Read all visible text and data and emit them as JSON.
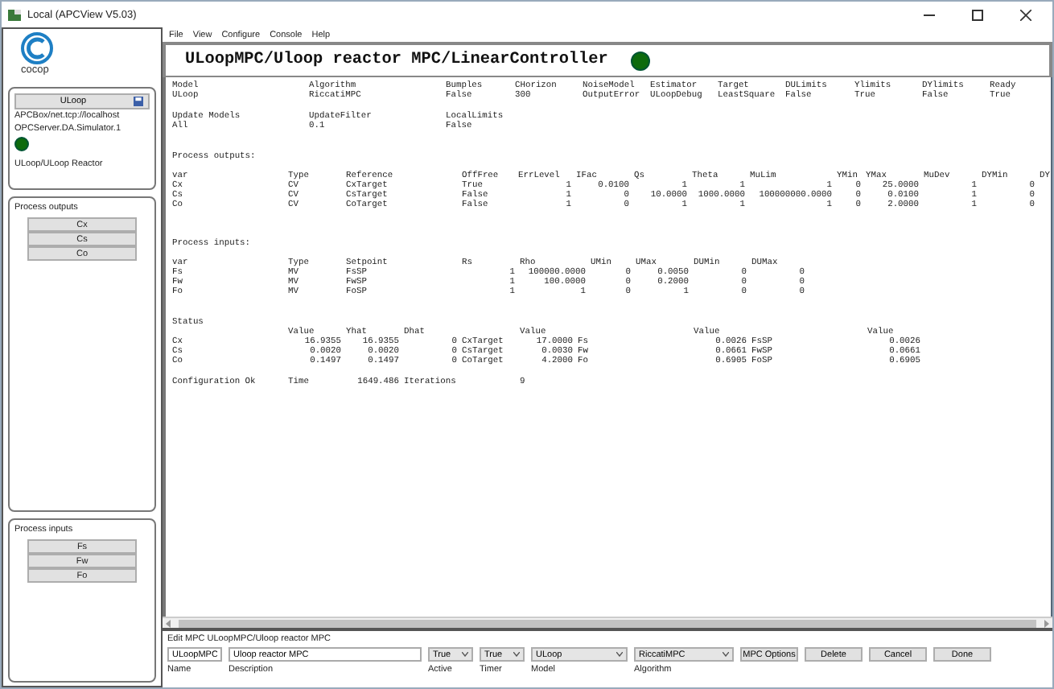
{
  "window": {
    "title": "Local (APCView V5.03)"
  },
  "sidebar": {
    "logo": "cocop",
    "controller": {
      "button": "ULoop",
      "lines": [
        "APCBox/net.tcp://localhost",
        "OPCServer.DA.Simulator.1"
      ],
      "connected": true,
      "path": "ULoop/ULoop Reactor"
    },
    "groups": [
      {
        "title": "Process outputs",
        "items": [
          "Cx",
          "Cs",
          "Co"
        ]
      },
      {
        "title": "Process inputs",
        "items": [
          "Fs",
          "Fw",
          "Fo"
        ]
      }
    ]
  },
  "menu": [
    "File",
    "View",
    "Configure",
    "Console",
    "Help"
  ],
  "header": {
    "title": "ULoopMPC/Uloop reactor MPC/LinearController",
    "running": true
  },
  "sections": [
    {
      "columns": [
        "Model",
        "Algorithm",
        "Bumples",
        "CHorizon",
        "NoiseModel",
        "Estimator",
        "Target",
        "DULimits",
        "Ylimits",
        "DYlimits",
        "Ready"
      ],
      "rows": [
        [
          "ULoop",
          "RiccatiMPC",
          "False",
          "300",
          "OutputError",
          "ULoopDebug",
          "LeastSquare",
          "False",
          "True",
          "False",
          "True"
        ]
      ]
    },
    {
      "columns": [
        "Update Models",
        "UpdateFilter",
        "LocalLimits"
      ],
      "rows": [
        [
          "All",
          "0.1",
          "False"
        ]
      ]
    },
    {
      "title": "Process outputs:",
      "columns": [
        "var",
        "Type",
        "Reference",
        "OffFree",
        "ErrLevel",
        "IFac",
        "Qs",
        "Theta",
        "MuLim",
        "YMin",
        "YMax",
        "MuDev",
        "DYMin",
        "DY"
      ],
      "rows": [
        [
          "Cx",
          "CV",
          "CxTarget",
          "True",
          "1",
          "0.0100",
          "1",
          "1",
          "1",
          "0",
          "25.0000",
          "1",
          "0"
        ],
        [
          "Cs",
          "CV",
          "CsTarget",
          "False",
          "1",
          "0",
          "10.0000",
          "1000.0000",
          "100000000.0000",
          "0",
          "0.0100",
          "1",
          "0"
        ],
        [
          "Co",
          "CV",
          "CoTarget",
          "False",
          "1",
          "0",
          "1",
          "1",
          "1",
          "0",
          "2.0000",
          "1",
          "0"
        ]
      ]
    },
    {
      "title": "Process inputs:",
      "columns": [
        "var",
        "Type",
        "Setpoint",
        "Rs",
        "Rho",
        "UMin",
        "UMax",
        "DUMin",
        "DUMax"
      ],
      "rows": [
        [
          "Fs",
          "MV",
          "FsSP",
          "1",
          "100000.0000",
          "0",
          "0.0050",
          "0",
          "0"
        ],
        [
          "Fw",
          "MV",
          "FwSP",
          "1",
          "100.0000",
          "0",
          "0.2000",
          "0",
          "0"
        ],
        [
          "Fo",
          "MV",
          "FoSP",
          "1",
          "1",
          "0",
          "1",
          "0",
          "0"
        ]
      ]
    },
    {
      "title": "Status",
      "columns": [
        null,
        "Value",
        "Yhat",
        "Dhat",
        null,
        "Value",
        null,
        "Value",
        null,
        "Value"
      ],
      "rows": [
        [
          "Cx",
          "16.9355",
          "16.9355",
          "0",
          "CxTarget",
          "17.0000",
          "Fs",
          "0.0026",
          "FsSP",
          "0.0026"
        ],
        [
          "Cs",
          "0.0020",
          "0.0020",
          "0",
          "CsTarget",
          "0.0030",
          "Fw",
          "0.0661",
          "FwSP",
          "0.0661"
        ],
        [
          "Co",
          "0.1497",
          "0.1497",
          "0",
          "CoTarget",
          "4.2000",
          "Fo",
          "0.6905",
          "FoSP",
          "0.6905"
        ]
      ]
    },
    {
      "rows": [
        [
          "Configuration Ok",
          "Time",
          "1649.486",
          "Iterations",
          "9"
        ]
      ]
    }
  ],
  "edit": {
    "title": "Edit MPC ULoopMPC/Uloop reactor MPC",
    "fields": [
      {
        "kind": "text",
        "value": "ULoopMPC",
        "label": "Name"
      },
      {
        "kind": "text",
        "value": "Uloop reactor MPC",
        "label": "Description"
      },
      {
        "kind": "select",
        "value": "True",
        "label": "Active"
      },
      {
        "kind": "select",
        "value": "True",
        "label": "Timer"
      },
      {
        "kind": "select",
        "value": "ULoop",
        "label": "Model"
      },
      {
        "kind": "select",
        "value": "RiccatiMPC",
        "label": "Algorithm"
      }
    ],
    "buttons": [
      "MPC Options",
      "Delete",
      "Cancel",
      "Done"
    ]
  }
}
